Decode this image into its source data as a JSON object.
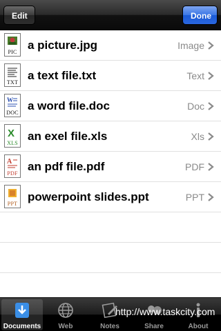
{
  "navbar": {
    "edit_label": "Edit",
    "done_label": "Done"
  },
  "files": [
    {
      "name": "a picture.jpg",
      "type": "Image",
      "icon_ext": "PIC",
      "icon": "picture-file-icon",
      "accent": "#6b8e3a"
    },
    {
      "name": "a text file.txt",
      "type": "Text",
      "icon_ext": "TXT",
      "icon": "text-file-icon",
      "accent": "#333333"
    },
    {
      "name": "a word file.doc",
      "type": "Doc",
      "icon_ext": "DOC",
      "icon": "word-file-icon",
      "accent": "#2a4fb0"
    },
    {
      "name": "an exel file.xls",
      "type": "Xls",
      "icon_ext": "XLS",
      "icon": "excel-file-icon",
      "accent": "#2a8a2a"
    },
    {
      "name": "an pdf file.pdf",
      "type": "PDF",
      "icon_ext": "PDF",
      "icon": "pdf-file-icon",
      "accent": "#c0392b"
    },
    {
      "name": "powerpoint slides.ppt",
      "type": "PPT",
      "icon_ext": "PPT",
      "icon": "powerpoint-file-icon",
      "accent": "#d9822b"
    }
  ],
  "tabs": [
    {
      "label": "Documents",
      "icon": "documents-download-icon",
      "active": true
    },
    {
      "label": "Web",
      "icon": "globe-icon",
      "active": false
    },
    {
      "label": "Notes",
      "icon": "notes-icon",
      "active": false
    },
    {
      "label": "Share",
      "icon": "share-icon",
      "active": false
    },
    {
      "label": "About",
      "icon": "info-icon",
      "active": false
    }
  ],
  "watermark": "http://www.taskcity.com",
  "colors": {
    "done_button": "#2a66de",
    "navbar": "#1c1c1c",
    "chevron": "#8a8a8a"
  }
}
